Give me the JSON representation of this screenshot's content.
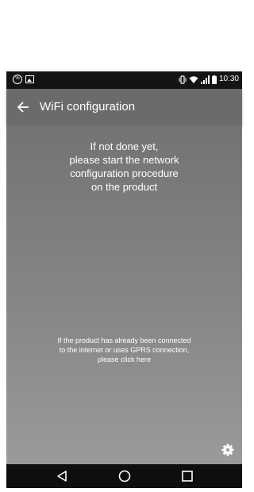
{
  "status_bar": {
    "time": "10:30",
    "left_icons": [
      "notification-percent-icon",
      "image-notification-icon"
    ],
    "right_icons": [
      "vibrate-icon",
      "wifi-icon",
      "signal-icon",
      "battery-icon"
    ]
  },
  "app_bar": {
    "title": "WiFi configuration",
    "back_icon": "back-arrow-icon"
  },
  "main": {
    "instruction": "If not done yet,\nplease start the network\nconfiguration procedure\non the product",
    "connected_link": "If the product has already been connected\nto the internet or uses GPRS connection,\nplease click here",
    "settings_icon": "gear-icon"
  },
  "nav_bar": {
    "buttons": [
      "back-triangle-icon",
      "home-circle-icon",
      "recents-square-icon"
    ]
  },
  "colors": {
    "status_bar": "#141414",
    "app_bar": "#6b6b6b",
    "content_top": "#737373",
    "content_bottom": "#9a9a9a",
    "nav_bar": "#0e0e0e",
    "text": "#ffffff"
  }
}
